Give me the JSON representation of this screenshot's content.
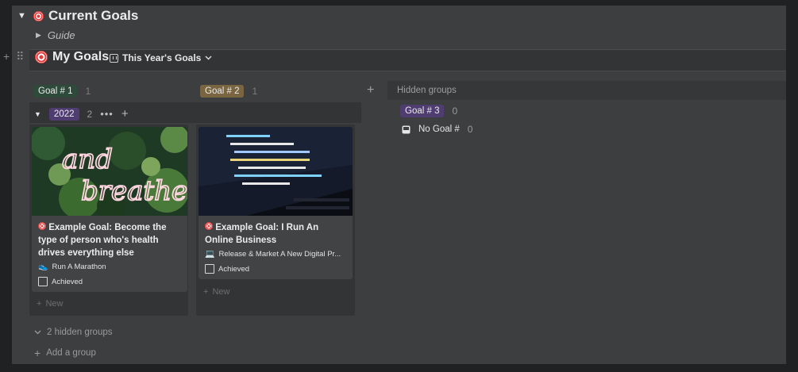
{
  "toggle": {
    "title": "Current Goals",
    "guide_label": "Guide"
  },
  "database": {
    "title": "My Goals",
    "view_label": "This Year's Goals",
    "chevron": "chevron-down-icon"
  },
  "columns": [
    {
      "label": "Goal # 1",
      "count": "1",
      "color": "#2e4a3b"
    },
    {
      "label": "Goal # 2",
      "count": "1",
      "color": "#7a6541"
    }
  ],
  "hidden_groups": {
    "title": "Hidden groups",
    "items": [
      {
        "label": "Goal # 3",
        "count": "0",
        "color": "#4f3d72"
      },
      {
        "label": "No Goal #",
        "count": "0",
        "icon": "inbox-icon"
      }
    ]
  },
  "sub_group": {
    "label": "2022",
    "count": "2",
    "color": "#4f3d72"
  },
  "cards": [
    {
      "title": "Example Goal: Become the type of person who's health drives everything else",
      "project": "Run A Marathon",
      "checkbox_label": "Achieved"
    },
    {
      "title": "Example Goal: I Run An Online Business",
      "project": "Release & Market A New Digital Pr...",
      "checkbox_label": "Achieved"
    }
  ],
  "cover_text": [
    "and",
    "breathe"
  ],
  "new_label": "New",
  "footer": {
    "hidden_groups": "2 hidden groups",
    "add_group": "Add a group"
  },
  "colors": {
    "background": "#202123",
    "panel": "#3d3e40",
    "card": "#424345"
  }
}
